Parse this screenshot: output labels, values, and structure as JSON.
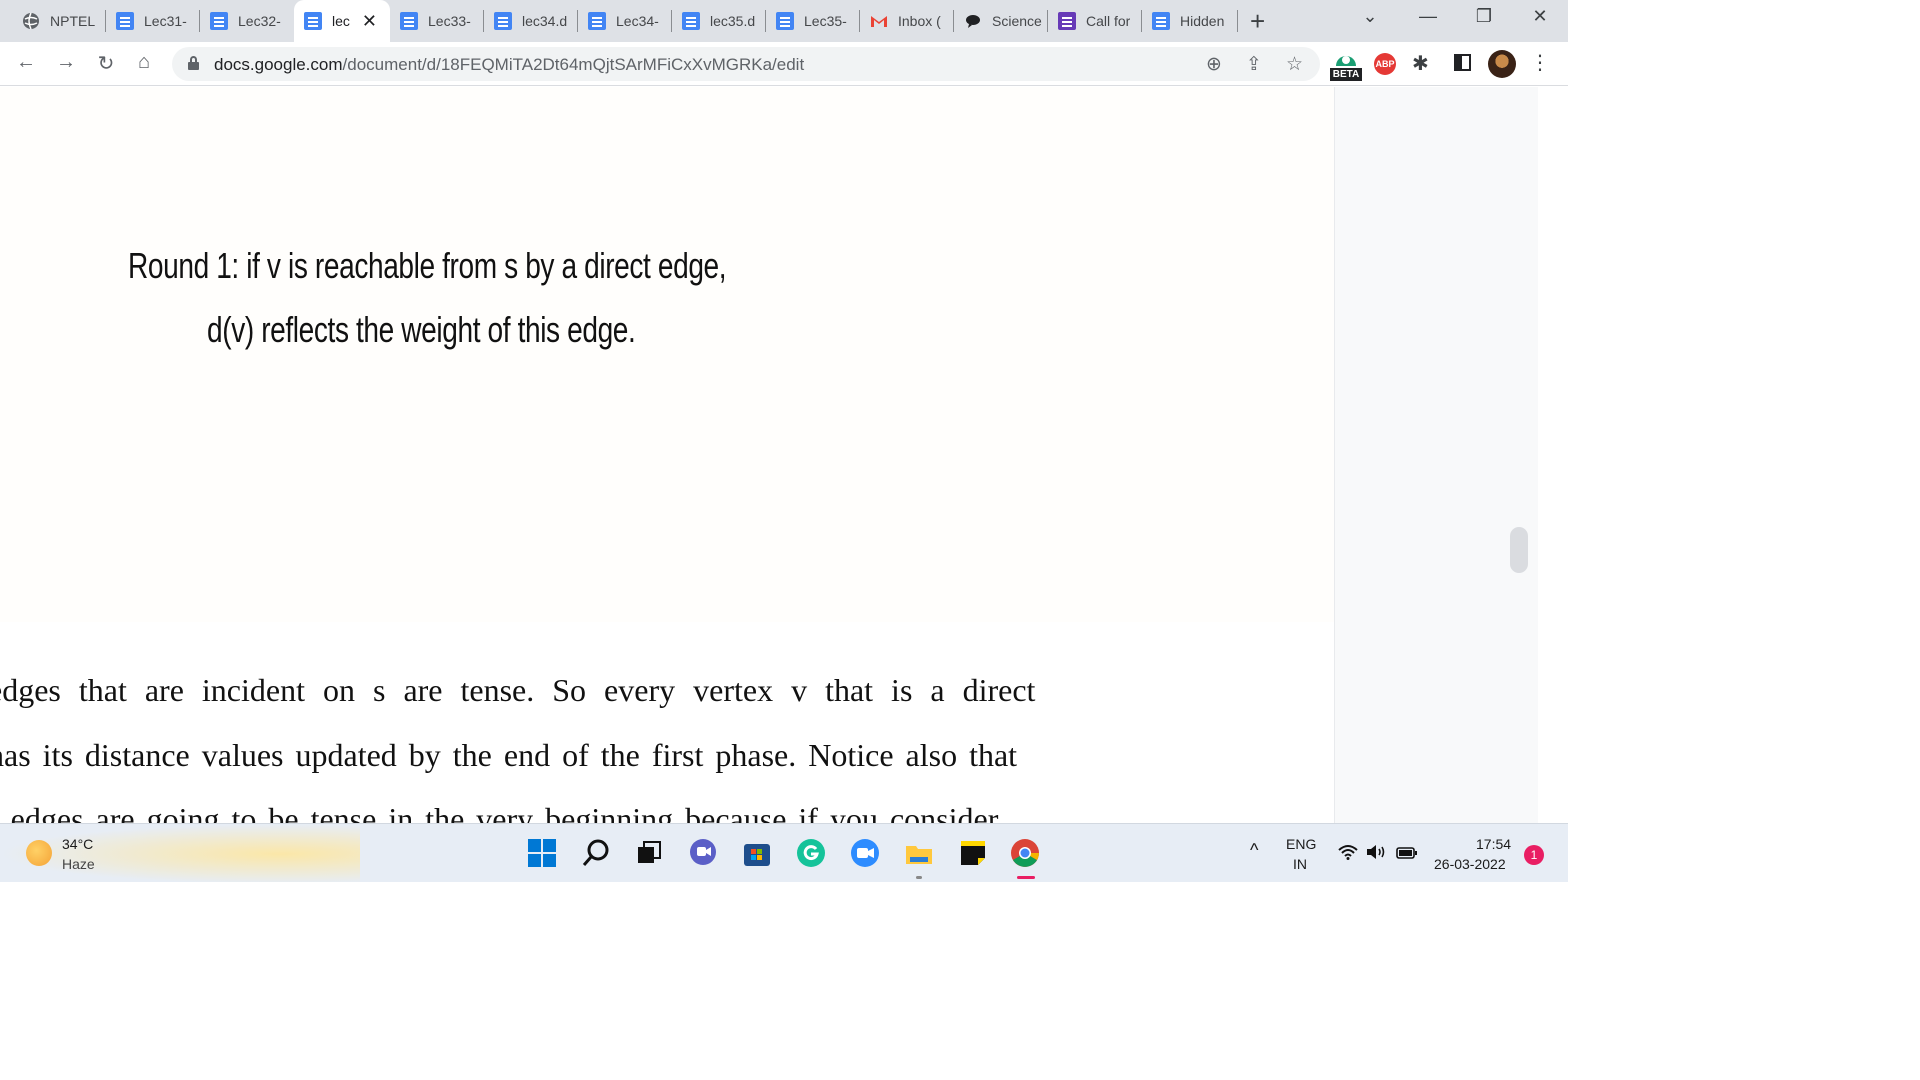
{
  "tabs": [
    {
      "label": "NPTEL",
      "icon": "globe-icon"
    },
    {
      "label": "Lec31-",
      "icon": "docs-icon"
    },
    {
      "label": "Lec32-",
      "icon": "docs-icon"
    },
    {
      "label": "lec",
      "icon": "docs-icon",
      "active": true,
      "close": "✕"
    },
    {
      "label": "Lec33-",
      "icon": "docs-icon"
    },
    {
      "label": "lec34.d",
      "icon": "docs-icon"
    },
    {
      "label": "Lec34-",
      "icon": "docs-icon"
    },
    {
      "label": "lec35.d",
      "icon": "docs-icon"
    },
    {
      "label": "Lec35-",
      "icon": "docs-icon"
    },
    {
      "label": "Inbox (",
      "icon": "gmail-icon"
    },
    {
      "label": "Science",
      "icon": "chat-icon"
    },
    {
      "label": "Call for",
      "icon": "forms-icon"
    },
    {
      "label": "Hidden",
      "icon": "docs-icon"
    }
  ],
  "new_tab": "+",
  "window_controls": {
    "dropdown": "⌄",
    "minimize": "—",
    "restore": "❐",
    "close": "✕"
  },
  "address": {
    "host": "docs.google.com",
    "path": "/document/d/18FEQMiTA2Dt64mQjtSArMFiCxXvMGRKa/edit"
  },
  "extensions": {
    "beta_label": "BETA",
    "abp_label": "ABP"
  },
  "slide": {
    "line1": "Round 1: if v is reachable from s by a direct edge,",
    "line2": "d(v) reflects the weight of this edge."
  },
  "document_text": [
    "edges  that  are  incident  on  s  are  tense.  So  every  vertex  v  that  is  a  direct",
    "has its distance values updated by the end of the first phase. Notice also that",
    "r edges are going to be tense in the very beginning because if you consider"
  ],
  "taskbar": {
    "weather_temp": "34°C",
    "weather_desc": "Haze",
    "lang_top": "ENG",
    "lang_bottom": "IN",
    "time": "17:54",
    "date": "26-03-2022",
    "notification_count": "1"
  },
  "colors": {
    "tabstrip": "#dee1e6",
    "docs_blue": "#4285f4",
    "chrome_accent": "#e91e63"
  }
}
